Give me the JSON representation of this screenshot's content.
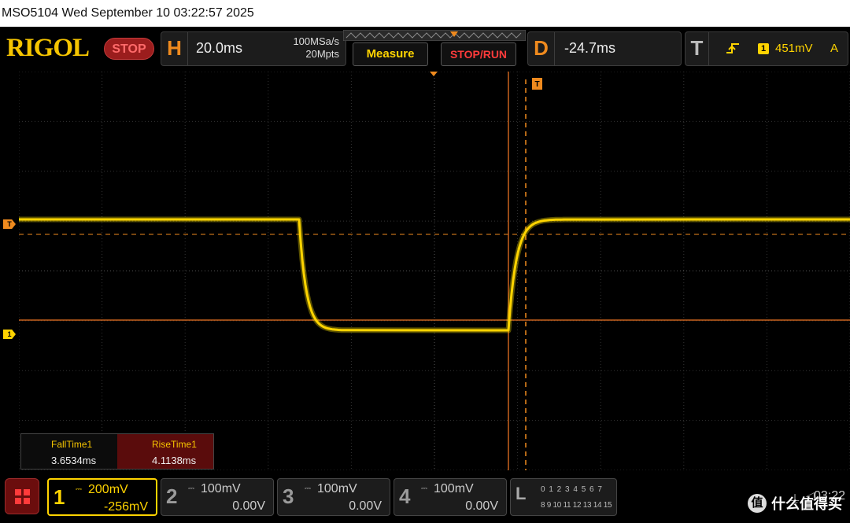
{
  "title_strip": {
    "text": "MSO5104  Wed September 10 03:22:57 2025"
  },
  "brand": {
    "logo": "RIGOL",
    "run_state": "STOP"
  },
  "horizontal": {
    "letter": "H",
    "scale": "20.0ms",
    "sample_rate": "100MSa/s",
    "memory_depth": "20Mpts"
  },
  "buttons": {
    "measure": "Measure",
    "stop_run": "STOP/RUN"
  },
  "delay": {
    "letter": "D",
    "value": "-24.7ms"
  },
  "trigger": {
    "letter": "T",
    "edge_icon": "rising-edge-icon",
    "source_badge": "1",
    "level": "451mV",
    "mode": "A"
  },
  "markers": {
    "trigger_level": "T",
    "ch1_ground": "1"
  },
  "measurements": [
    {
      "label": "FallTime1",
      "value": "3.6534ms"
    },
    {
      "label": "RiseTime1",
      "value": "4.1138ms"
    }
  ],
  "channels": [
    {
      "num": "1",
      "coupling": "DC",
      "scale": "200mV",
      "offset": "-256mV",
      "color": "#ffd400",
      "active": true
    },
    {
      "num": "2",
      "coupling": "DC",
      "scale": "100mV",
      "offset": "0.00V",
      "color": "#9a9a9a",
      "active": false
    },
    {
      "num": "3",
      "coupling": "DC",
      "scale": "100mV",
      "offset": "0.00V",
      "color": "#9a9a9a",
      "active": false
    },
    {
      "num": "4",
      "coupling": "DC",
      "scale": "100mV",
      "offset": "0.00V",
      "color": "#9a9a9a",
      "active": false
    }
  ],
  "logic": {
    "letter": "L",
    "row1": "0 1 2 3  4 5 6 7",
    "row2": "8 9 10 11 12 13 14 15"
  },
  "status": {
    "clock": "03:22"
  },
  "watermark": {
    "badge": "值",
    "text": "什么值得买"
  },
  "colors": {
    "trace": "#ffd400",
    "accent": "#ef8a1e",
    "cursor": "#c9621e",
    "grid": "#3a3a3a"
  }
}
